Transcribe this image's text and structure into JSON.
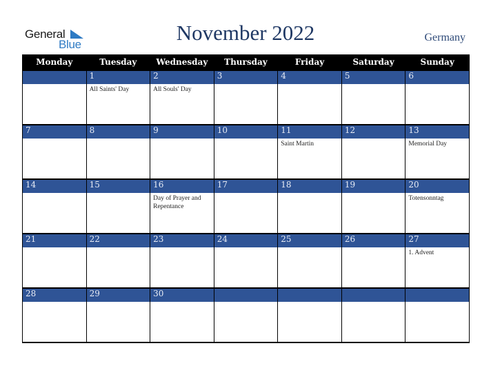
{
  "logo": {
    "word1": "General",
    "word2": "Blue"
  },
  "title": "November 2022",
  "country": "Germany",
  "colors": {
    "header_bg": "#000000",
    "day_band": "#2f5496",
    "title": "#1f3864",
    "logo_blue": "#2f7bc4"
  },
  "weekdays": [
    "Monday",
    "Tuesday",
    "Wednesday",
    "Thursday",
    "Friday",
    "Saturday",
    "Sunday"
  ],
  "weeks": [
    {
      "days": [
        {
          "num": "",
          "event": ""
        },
        {
          "num": "1",
          "event": "All Saints' Day"
        },
        {
          "num": "2",
          "event": "All Souls' Day"
        },
        {
          "num": "3",
          "event": ""
        },
        {
          "num": "4",
          "event": ""
        },
        {
          "num": "5",
          "event": ""
        },
        {
          "num": "6",
          "event": ""
        }
      ]
    },
    {
      "days": [
        {
          "num": "7",
          "event": ""
        },
        {
          "num": "8",
          "event": ""
        },
        {
          "num": "9",
          "event": ""
        },
        {
          "num": "10",
          "event": ""
        },
        {
          "num": "11",
          "event": "Saint Martin"
        },
        {
          "num": "12",
          "event": ""
        },
        {
          "num": "13",
          "event": "Memorial Day"
        }
      ]
    },
    {
      "days": [
        {
          "num": "14",
          "event": ""
        },
        {
          "num": "15",
          "event": ""
        },
        {
          "num": "16",
          "event": "Day of Prayer and Repentance"
        },
        {
          "num": "17",
          "event": ""
        },
        {
          "num": "18",
          "event": ""
        },
        {
          "num": "19",
          "event": ""
        },
        {
          "num": "20",
          "event": "Totensonntag"
        }
      ]
    },
    {
      "days": [
        {
          "num": "21",
          "event": ""
        },
        {
          "num": "22",
          "event": ""
        },
        {
          "num": "23",
          "event": ""
        },
        {
          "num": "24",
          "event": ""
        },
        {
          "num": "25",
          "event": ""
        },
        {
          "num": "26",
          "event": ""
        },
        {
          "num": "27",
          "event": "1. Advent"
        }
      ]
    },
    {
      "days": [
        {
          "num": "28",
          "event": ""
        },
        {
          "num": "29",
          "event": ""
        },
        {
          "num": "30",
          "event": ""
        },
        {
          "num": "",
          "event": ""
        },
        {
          "num": "",
          "event": ""
        },
        {
          "num": "",
          "event": ""
        },
        {
          "num": "",
          "event": ""
        }
      ]
    }
  ]
}
